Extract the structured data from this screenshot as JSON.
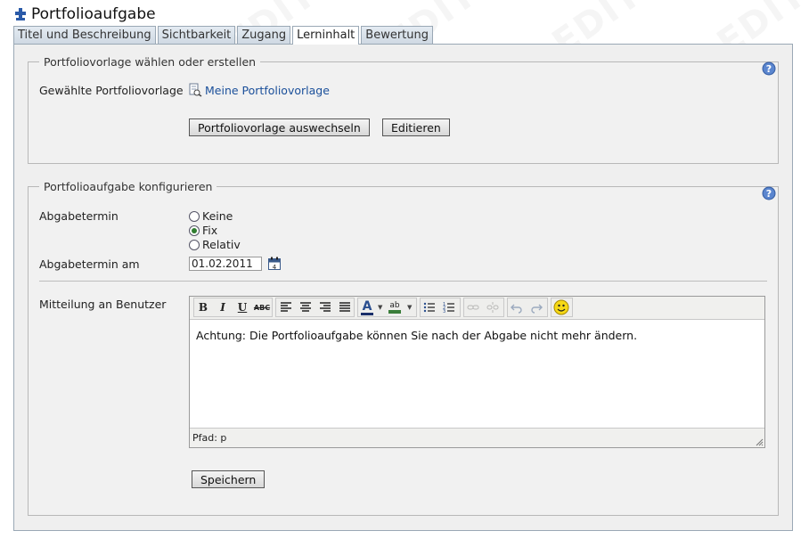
{
  "page": {
    "title": "Portfolioaufgabe",
    "watermark": "EDIT"
  },
  "tabs": [
    {
      "label": "Titel und Beschreibung",
      "active": false
    },
    {
      "label": "Sichtbarkeit",
      "active": false
    },
    {
      "label": "Zugang",
      "active": false
    },
    {
      "label": "Lerninhalt",
      "active": true
    },
    {
      "label": "Bewertung",
      "active": false
    }
  ],
  "template_section": {
    "legend": "Portfoliovorlage wählen oder erstellen",
    "selected_label": "Gewählte Portfoliovorlage",
    "selected_value": "Meine Portfoliovorlage",
    "swap_button": "Portfoliovorlage auswechseln",
    "edit_button": "Editieren"
  },
  "config_section": {
    "legend": "Portfolioaufgabe konfigurieren",
    "deadline_label": "Abgabetermin",
    "deadline_options": [
      {
        "label": "Keine",
        "selected": false
      },
      {
        "label": "Fix",
        "selected": true
      },
      {
        "label": "Relativ",
        "selected": false
      }
    ],
    "deadline_date_label": "Abgabetermin am",
    "deadline_date_value": "01.02.2011",
    "calendar_day": "4",
    "message_label": "Mitteilung an Benutzer",
    "editor": {
      "content": "Achtung: Die Portfolioaufgabe können Sie nach der Abgabe nicht mehr ändern.",
      "path": "Pfad: p",
      "toolbar": {
        "bold": "B",
        "italic": "I",
        "underline": "U",
        "strike": "ABC",
        "font_color": "A",
        "highlight": "ab"
      }
    },
    "save_button": "Speichern"
  },
  "colors": {
    "link": "#1a4f9a",
    "panel": "#efefef",
    "tab_border": "#9aa8b5"
  }
}
